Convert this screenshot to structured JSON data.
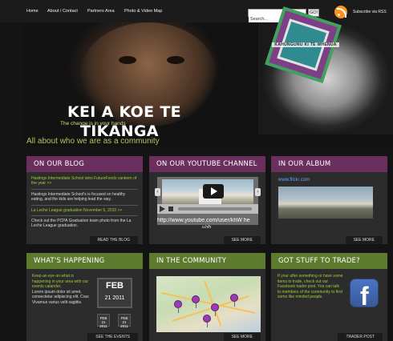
{
  "nav": {
    "items": [
      "Home",
      "About / Contact",
      "Partners Area",
      "Photo & Video Map"
    ],
    "search_value": "Search...",
    "go_label": "GO!",
    "rss_label": "Subscribe via RSS"
  },
  "hero": {
    "title_line1": "KEI A KOE TE",
    "title_line2": "TIKANGA",
    "subtitle": "The change is in your hands",
    "logo_text": "KAHUNGUNU KI TE WHENUA"
  },
  "tagline": "All about who we are as a community",
  "blog": {
    "heading": "ON OUR BLOG",
    "post1_title": "Hastings Intermediate School wins FutureFoods canteen of the year >>",
    "post1_body": "Hastings Intermediate School's is focused on healthy eating, and the kids are helping lead the way.",
    "post2_title": "La Leche League graduation November 5, 2010 >>",
    "post2_body": "Check out the PCPA Graduation team photo from the La Leche League graduation.",
    "footer": "READ THE BLOG"
  },
  "youtube": {
    "heading": "ON OUR YOUTUBE CHANNEL",
    "url": "http://www.youtube.com/user/khW he",
    "url_tail": "u.h/h",
    "footer": "SEE MORE"
  },
  "album": {
    "heading": "IN OUR ALBUM",
    "flickr_prefix": "www.flick",
    "flickr_mid": "r",
    "flickr_suffix": ".com",
    "footer": "SEE MORE"
  },
  "happening": {
    "heading": "WHAT'S HAPPENING",
    "intro": "Keep an eye on what is happening in your area with our events calander.",
    "lorem": "Lorem ipsum dolor sit amet, consectetur adipiscing elit. Cras Vivamus varius velit sagittis.",
    "cal_month": "FEB",
    "cal_date": "21 2011",
    "small1_month": "FEB",
    "small1_date": "21 2011",
    "small2_month": "FEB",
    "small2_date": "21 2011",
    "footer": "SEE THE EVENTS"
  },
  "community": {
    "heading": "IN THE COMMUNITY",
    "footer": "SEE MORE"
  },
  "trade": {
    "heading": "GOT STUFF TO TRADE?",
    "body": "If your after something or have some items to trade, check out our Facebook trader post. You can talk to members of the community to find some like minded people.",
    "facebook_letter": "f",
    "footer": "TRADER POST"
  },
  "colors": {
    "purple_header": "#6b2f5e",
    "green_header": "#5d7b2e",
    "accent_green": "#9fce3a",
    "rss_orange": "#f7931e"
  },
  "icons": [
    "rss-icon",
    "play-icon",
    "facebook-icon",
    "calendar-icon",
    "map-pin-icon"
  ]
}
